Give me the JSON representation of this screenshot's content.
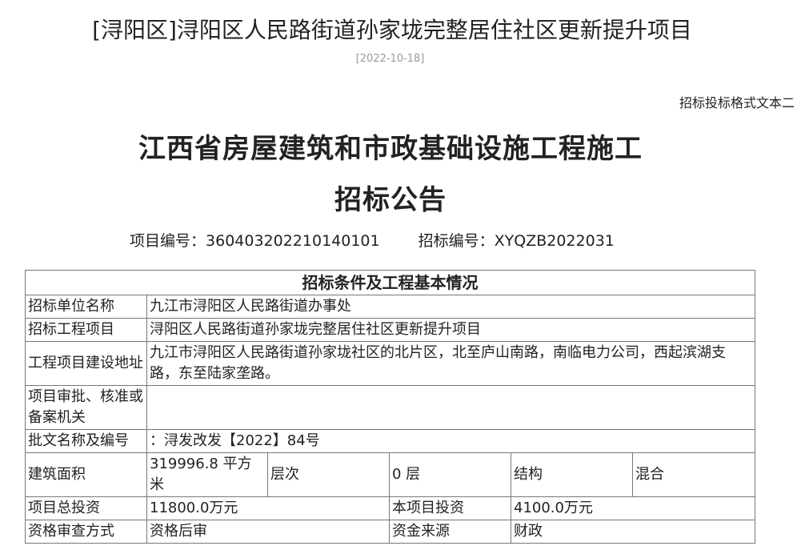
{
  "header": {
    "title": "[浔阳区]浔阳区人民路街道孙家垅完整居住社区更新提升项目",
    "date": "[2022-10-18]"
  },
  "document": {
    "format_label": "招标投标格式文本二",
    "heading_line1": "江西省房屋建筑和市政基础设施工程施工",
    "heading_line2": "招标公告",
    "project_no_label": "项目编号：",
    "project_no": "360403202210140101",
    "bid_no_label": "招标编号：",
    "bid_no": "XYQZB2022031"
  },
  "table": {
    "heading": "招标条件及工程基本情况",
    "rows": {
      "tenderer": {
        "label": "招标单位名称",
        "value": "九江市浔阳区人民路街道办事处"
      },
      "project": {
        "label": "招标工程项目",
        "value": "浔阳区人民路街道孙家垅完整居住社区更新提升项目"
      },
      "address": {
        "label": "工程项目建设地址",
        "value": "九江市浔阳区人民路街道孙家垅社区的北片区，北至庐山南路，南临电力公司，西起滨湖支路，东至陆家垄路。"
      },
      "approval_authority": {
        "label": "项目审批、核准或备案机关",
        "value": ""
      },
      "approval_doc": {
        "label": "批文名称及编号",
        "value": "：浔发改发【2022】84号"
      }
    },
    "area_row": {
      "area_label": "建筑面积",
      "area_value": "319996.8 平方米",
      "floors_label": "层次",
      "floors_value": "0 层",
      "structure_label": "结构",
      "structure_value": "混合"
    },
    "investment_row": {
      "total_label": "项目总投资",
      "total_value": "11800.0万元",
      "this_label": "本项目投资",
      "this_value": "4100.0万元"
    },
    "qualification_row": {
      "method_label": "资格审查方式",
      "method_value": "资格后审",
      "fund_label": "资金来源",
      "fund_value": "财政"
    }
  }
}
